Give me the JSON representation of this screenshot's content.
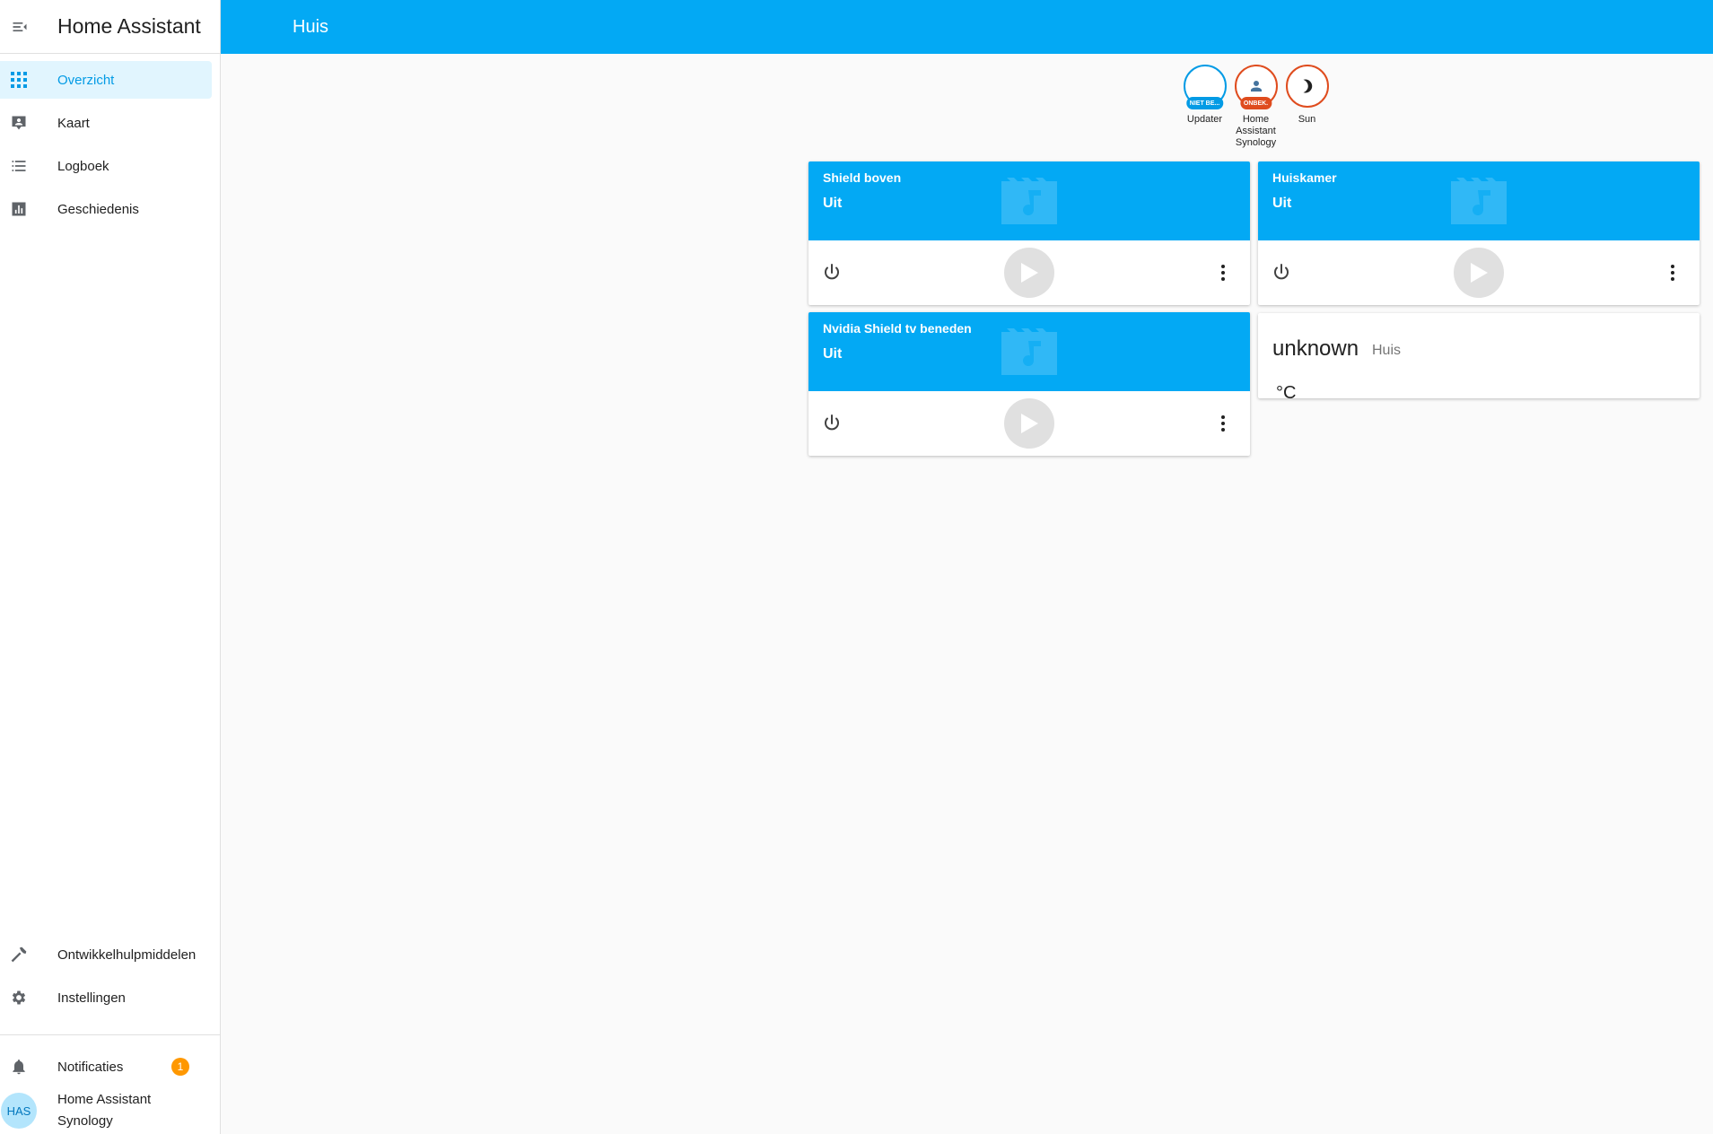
{
  "app": {
    "title": "Home Assistant"
  },
  "header": {
    "title": "Huis"
  },
  "sidebar": {
    "items": [
      {
        "label": "Overzicht",
        "icon": "view-dashboard-icon",
        "active": true
      },
      {
        "label": "Kaart",
        "icon": "map-account-icon"
      },
      {
        "label": "Logboek",
        "icon": "list-icon"
      },
      {
        "label": "Geschiedenis",
        "icon": "chart-bar-icon"
      }
    ],
    "bottom_items": [
      {
        "label": "Ontwikkelhulpmiddelen",
        "icon": "hammer-icon"
      },
      {
        "label": "Instellingen",
        "icon": "gear-icon"
      }
    ],
    "notifications": {
      "label": "Notificaties",
      "count": "1",
      "icon": "bell-icon"
    },
    "user": {
      "initials": "HAS",
      "name_line1": "Home Assistant",
      "name_line2": "Synology"
    }
  },
  "badges": [
    {
      "name": "Updater",
      "pill": "NIET BE...",
      "color": "#039be5",
      "icon": ""
    },
    {
      "name_lines": [
        "Home",
        "Assistant",
        "Synology"
      ],
      "pill": "ONBEK.",
      "color": "#df4c1e",
      "icon": "account-icon"
    },
    {
      "name": "Sun",
      "pill": "",
      "color": "#df4c1e",
      "icon": "moon-icon"
    }
  ],
  "media_players": [
    {
      "name": "Shield boven",
      "state": "Uit"
    },
    {
      "name": "Huiskamer",
      "state": "Uit"
    },
    {
      "name": "Nvidia Shield tv beneden",
      "state": "Uit"
    }
  ],
  "sensor": {
    "value": "unknown",
    "name": "Huis",
    "unit": "°C"
  },
  "colors": {
    "primary": "#03a9f4",
    "active_bg": "#e1f5fe",
    "badge": "#ff9800"
  }
}
